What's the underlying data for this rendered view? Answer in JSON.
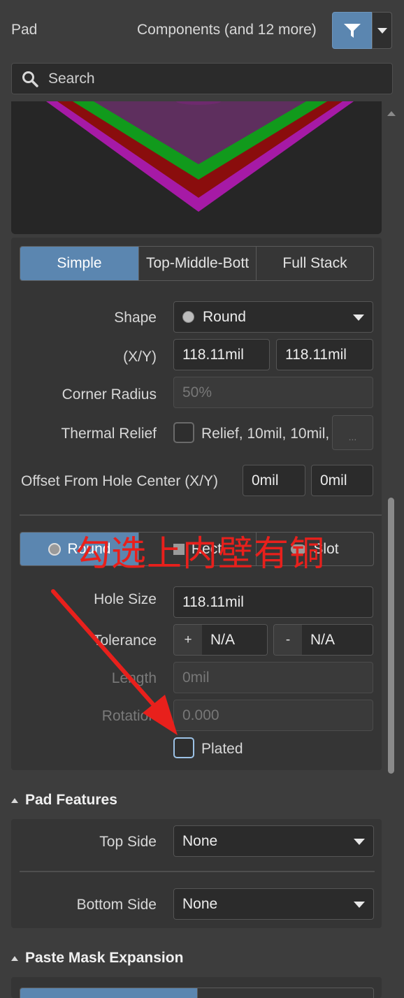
{
  "header": {
    "object_type": "Pad",
    "selection_summary": "Components (and 12 more)"
  },
  "search": {
    "placeholder": "Search"
  },
  "stack_mode_tabs": [
    "Simple",
    "Top-Middle-Bott",
    "Full Stack"
  ],
  "pad_shape": {
    "shape_label": "Shape",
    "shape_value": "Round",
    "xy_label": "(X/Y)",
    "x_value": "118.11mil",
    "y_value": "118.11mil",
    "corner_radius_label": "Corner Radius",
    "corner_radius_value": "50%",
    "thermal_relief_label": "Thermal Relief",
    "thermal_relief_value": "Relief, 10mil, 10mil,",
    "thermal_more_button": "...",
    "offset_label": "Offset From Hole Center (X/Y)",
    "offset_x": "0mil",
    "offset_y": "0mil"
  },
  "hole": {
    "hole_type_tabs": [
      "Round",
      "Rect",
      "Slot"
    ],
    "hole_size_label": "Hole Size",
    "hole_size_value": "118.11mil",
    "tolerance_label": "Tolerance",
    "tol_plus_sign": "+",
    "tol_plus_value": "N/A",
    "tol_minus_sign": "-",
    "tol_minus_value": "N/A",
    "length_label": "Length",
    "length_value": "0mil",
    "rotation_label": "Rotation",
    "rotation_value": "0.000",
    "plated_label": "Plated"
  },
  "annotation": {
    "text": "勾选上内壁有铜",
    "color": "#e8201c"
  },
  "pad_features": {
    "title": "Pad Features",
    "top_side_label": "Top Side",
    "top_side_value": "None",
    "bottom_side_label": "Bottom Side",
    "bottom_side_value": "None"
  },
  "paste_mask": {
    "title": "Paste Mask Expansion"
  },
  "colors": {
    "accent": "#5b86b0",
    "pad_preview_green": "#119a1c",
    "pad_preview_red": "#8a0d0d",
    "pad_preview_magenta": "#a61aa6"
  }
}
